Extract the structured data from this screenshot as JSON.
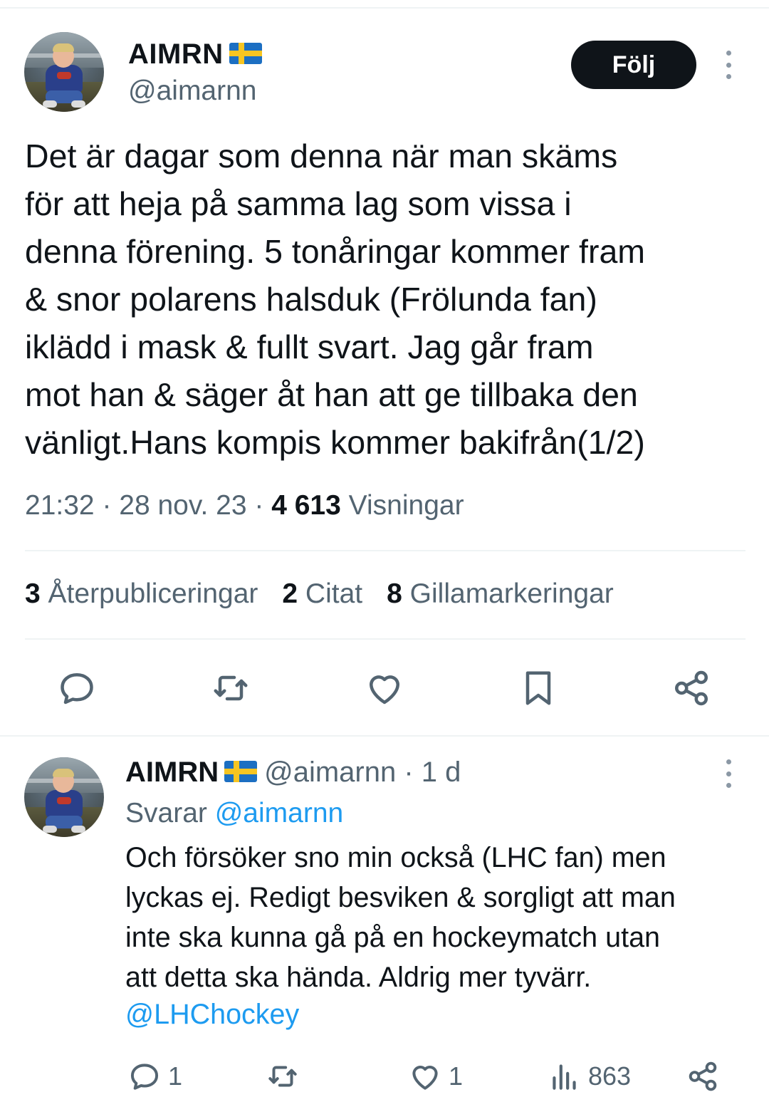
{
  "tweet": {
    "display_name": "AIMRN",
    "flag": "swedish-flag",
    "handle": "@aimarnn",
    "follow_label": "Följ",
    "text": "Det är dagar som denna när man skäms\nför att heja på samma lag som vissa i\ndenna förening. 5 tonåringar kommer fram\n& snor polarens halsduk (Frölunda fan)\niklädd i mask & fullt svart. Jag går fram\nmot han & säger åt han att ge tillbaka den\nvänligt.Hans kompis kommer bakifrån(1/2)",
    "time": "21:32",
    "date": "28 nov. 23",
    "views_count": "4 613",
    "views_label": "Visningar",
    "stats": {
      "reposts_count": "3",
      "reposts_label": "Återpubliceringar",
      "quotes_count": "2",
      "quotes_label": "Citat",
      "likes_count": "8",
      "likes_label": "Gillamarkeringar"
    },
    "action_icons": [
      "reply-icon",
      "repost-icon",
      "like-icon",
      "bookmark-icon",
      "share-icon"
    ]
  },
  "reply": {
    "display_name": "AIMRN",
    "handle": "@aimarnn",
    "age": "· 1 d",
    "replying_prefix": "Svarar",
    "replying_to": "@aimarnn",
    "text": "Och försöker sno min också (LHC fan) men\nlyckas ej. Redigt besviken & sorgligt att man\ninte ska kunna gå på en hockeymatch utan\natt detta ska hända. Aldrig mer tyvärr.",
    "mention": "@LHChockey",
    "reply_count": "1",
    "like_count": "1",
    "views_count": "863"
  },
  "colors": {
    "text": "#0f1419",
    "secondary": "#536471",
    "link": "#1d9bf0",
    "divider": "#eff3f4",
    "button": "#0f1419"
  }
}
